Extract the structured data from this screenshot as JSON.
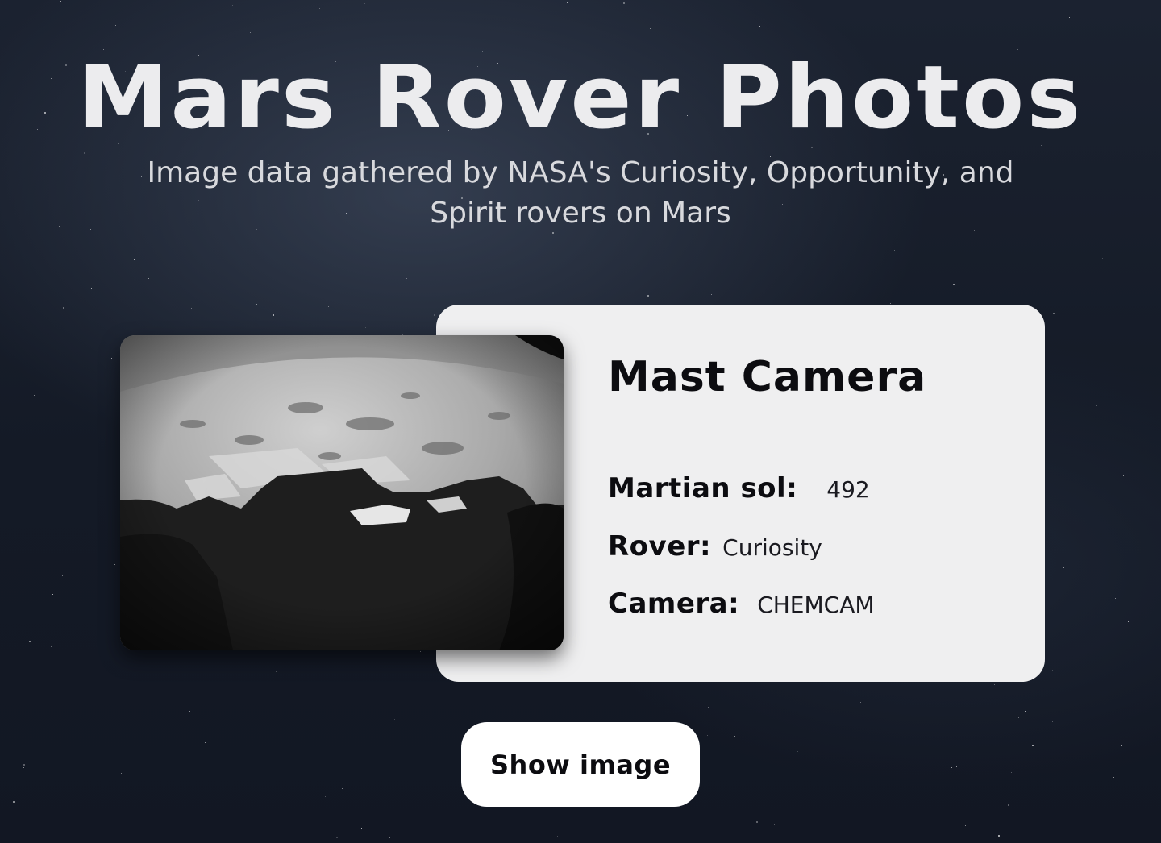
{
  "header": {
    "title": "Mars Rover Photos",
    "subtitle": "Image data gathered by NASA's Curiosity, Opportunity, and Spirit rovers on Mars"
  },
  "photo": {
    "kind": "grayscale rover hazard-camera photo of Martian terrain with rover shadow"
  },
  "card": {
    "camera_full_name": "Mast Camera",
    "details": {
      "sol_label": "Martian sol:",
      "sol_value": "492",
      "rover_label": "Rover:",
      "rover_value": "Curiosity",
      "camera_label": "Camera:",
      "camera_value": "CHEMCAM"
    }
  },
  "actions": {
    "show_image_label": "Show image"
  },
  "colors": {
    "background": "#141a26",
    "card": "#efeff0",
    "button": "#ffffff",
    "heading_text": "#ececee",
    "dark_text": "#0c0c10"
  }
}
